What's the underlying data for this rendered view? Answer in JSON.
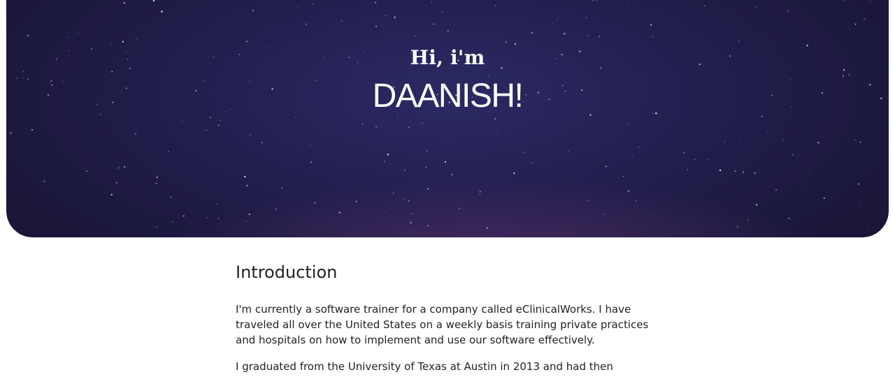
{
  "hero": {
    "greeting": "Hi, i'm",
    "name": "DAANISH!"
  },
  "intro": {
    "title": "Introduction",
    "paragraphs": [
      "I'm currently a software trainer for a company called eClinicalWorks. I have traveled all over the United States on a weekly basis training private practices and hospitals on how to implement and use our software effectively.",
      "I graduated from the University of Texas at Austin in 2013 and had then"
    ]
  },
  "colors": {
    "hero_background": "#211d4c",
    "text": "#222222",
    "page_background": "#ffffff"
  }
}
